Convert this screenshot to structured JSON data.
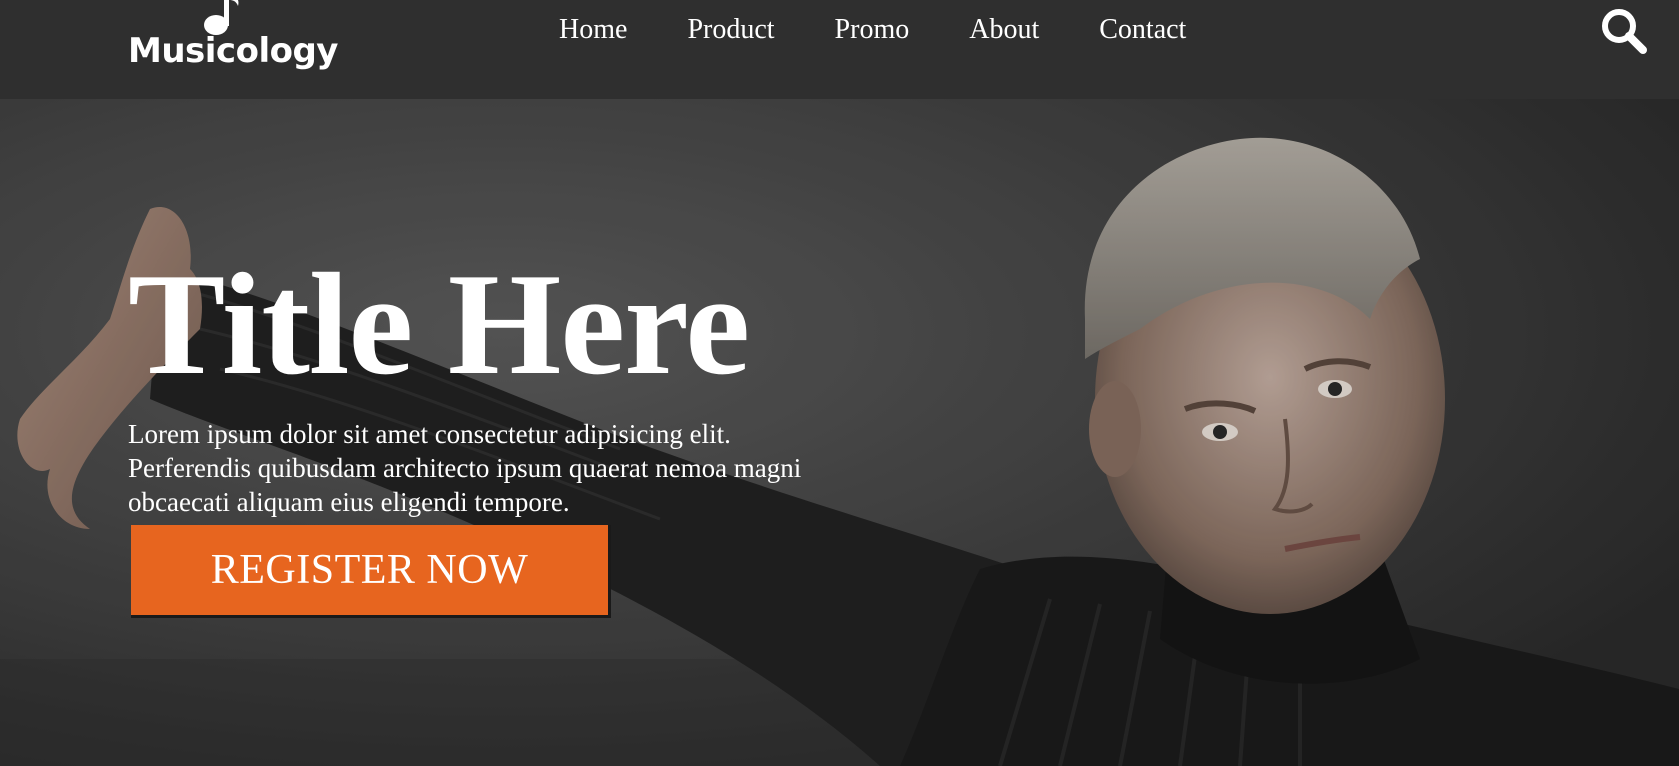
{
  "brand": {
    "name": "Musicology",
    "icon": "music-note-icon"
  },
  "nav": {
    "items": [
      {
        "label": "Home"
      },
      {
        "label": "Product"
      },
      {
        "label": "Promo"
      },
      {
        "label": "About"
      },
      {
        "label": "Contact"
      }
    ],
    "search_icon": "search-icon"
  },
  "hero": {
    "title": "Title Here",
    "text": "Lorem ipsum dolor sit amet consectetur adipisicing elit. Perferendis quibusdam architecto ipsum quaerat nemoa magni obcaecati aliquam eius eligendi tempore.",
    "cta_label": "REGISTER NOW"
  },
  "colors": {
    "navbar": "#2f2f2f",
    "accent": "#e7651f",
    "text": "#ffffff"
  }
}
